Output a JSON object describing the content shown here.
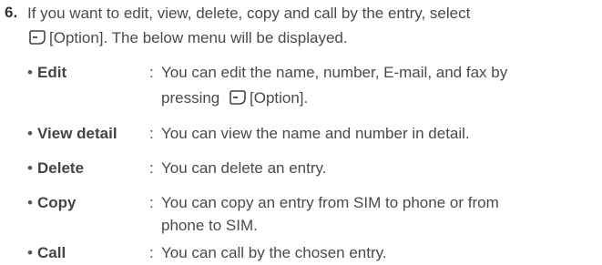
{
  "step": {
    "number": "6.",
    "line1": "If you want to edit, view, delete, copy and call by the entry, select",
    "line2_key_label": "[Option]. The below menu will be displayed."
  },
  "items": [
    {
      "term": "Edit",
      "desc1": "You can edit the name, number, E-mail, and fax by",
      "desc2_prefix": "pressing",
      "desc2_suffix": "[Option]."
    },
    {
      "term": "View detail",
      "desc1": "You can view the name and number in detail."
    },
    {
      "term": "Delete",
      "desc1": "You can delete an entry."
    },
    {
      "term": "Copy",
      "desc1": "You can copy an entry from SIM to phone or from",
      "desc2": "phone to SIM."
    },
    {
      "term": "Call",
      "desc1": "You can call by the chosen entry."
    }
  ],
  "bullet": "•",
  "colon": ":",
  "icons": {
    "softkey": "left-soft-key-icon"
  }
}
